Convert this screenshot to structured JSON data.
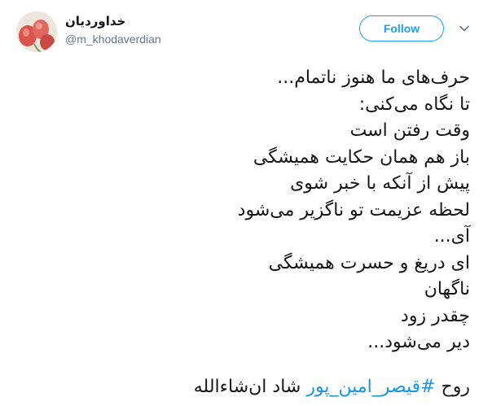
{
  "author": {
    "display_name": "خداوردیان",
    "handle": "@m_khodaverdian",
    "avatar_icon": "avatar-icon"
  },
  "actions": {
    "follow_label": "Follow",
    "menu_icon": "chevron-down-icon"
  },
  "tweet": {
    "lines": [
      "حرف‌های ما هنوز ناتمام...",
      "تا نگاه می‌کنی:",
      "وقت رفتن است",
      "باز هم همان حکایت همیشگی",
      "پیش از آنکه با خبر شوی",
      "لحظه عزیمت تو ناگزیر می‌شود",
      "آی...",
      "ای دریغ و حسرت همیشگی",
      "ناگهان",
      "چقدر زود",
      "دیر می‌شود..."
    ],
    "final_prefix": "روح ",
    "hashtag": "#قیصر_امین_پور",
    "final_suffix": " شاد ان‌شاءالله"
  },
  "colors": {
    "accent": "#1da1f2",
    "hashtag": "#1b95e0",
    "text": "#14171a",
    "muted": "#657786"
  }
}
